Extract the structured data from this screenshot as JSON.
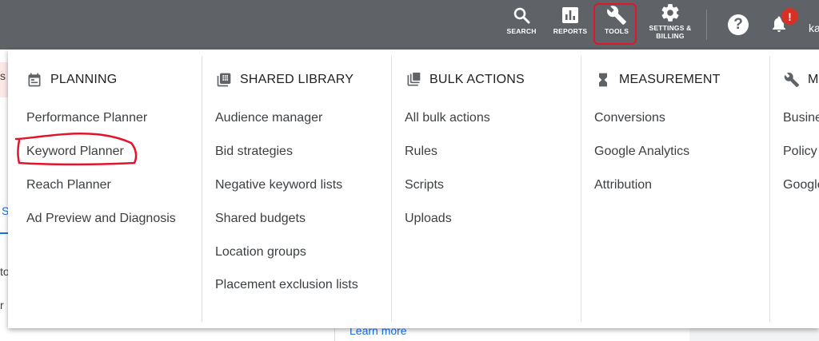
{
  "topbar": {
    "search_label": "SEARCH",
    "reports_label": "REPORTS",
    "tools_label": "TOOLS",
    "settings_label_line1": "SETTINGS &",
    "settings_label_line2": "BILLING",
    "help_glyph": "?",
    "alert_glyph": "!",
    "account_fragment": "ka",
    "colors": {
      "bar": "#5f6368",
      "alert": "#d93025",
      "annotation": "#e0142b"
    }
  },
  "background": {
    "frag_1": "s",
    "frag_2": "to",
    "frag_3": "r",
    "tab_fragment": "S",
    "learn_more": "Learn more"
  },
  "menu": {
    "columns": [
      {
        "heading": "PLANNING",
        "icon": "calendar-icon",
        "items": [
          "Performance Planner",
          "Keyword Planner",
          "Reach Planner",
          "Ad Preview and Diagnosis"
        ]
      },
      {
        "heading": "SHARED LIBRARY",
        "icon": "library-grid-icon",
        "items": [
          "Audience manager",
          "Bid strategies",
          "Negative keyword lists",
          "Shared budgets",
          "Location groups",
          "Placement exclusion lists"
        ]
      },
      {
        "heading": "BULK ACTIONS",
        "icon": "stacked-copies-icon",
        "items": [
          "All bulk actions",
          "Rules",
          "Scripts",
          "Uploads"
        ]
      },
      {
        "heading": "MEASUREMENT",
        "icon": "hourglass-icon",
        "items": [
          "Conversions",
          "Google Analytics",
          "Attribution"
        ]
      },
      {
        "heading": "M",
        "icon": "wrench-icon",
        "items": [
          "Busine",
          "Policy",
          "Google"
        ]
      }
    ]
  }
}
